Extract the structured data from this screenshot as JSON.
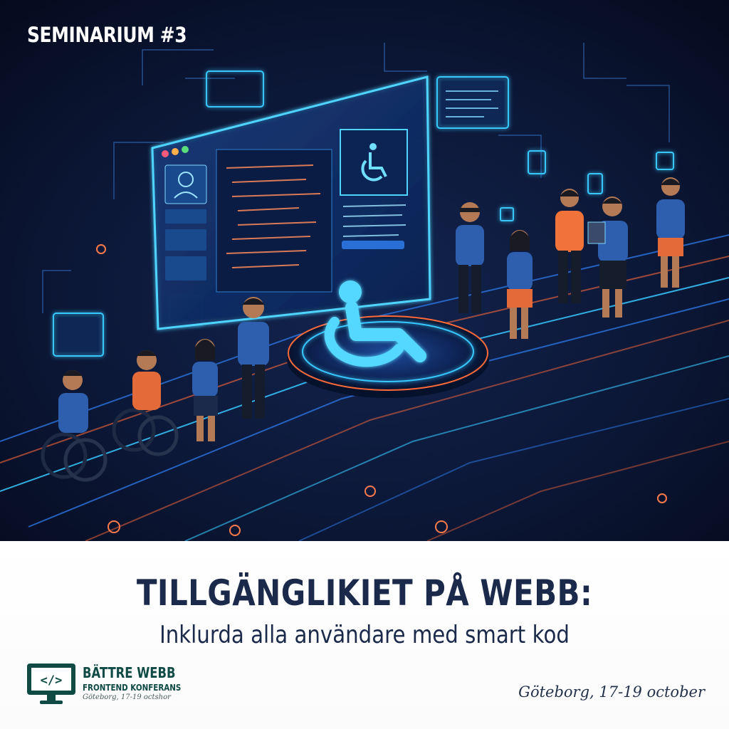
{
  "badge": "SEMINARIUM #3",
  "title": "TILLGÄNGLIKIET PÅ WEBB:",
  "subtitle": "Inklurda alla användare med smart kod",
  "logo": {
    "code_glyph": "</>",
    "name": "BÄTTRE WEBB",
    "tagline": "FRONTEND KONFERANS",
    "date": "Göteborg, 17-19 octshor"
  },
  "event_date": "Göteborg, 17-19 october",
  "colors": {
    "hero_bg": "#0a1430",
    "neon": "#38c8ff",
    "accent_orange": "#ff6a3a",
    "title_navy": "#1b2a4a",
    "logo_green": "#0f4a45"
  },
  "icons": [
    "wheelchair-icon",
    "user-profile-icon",
    "code-icon"
  ]
}
